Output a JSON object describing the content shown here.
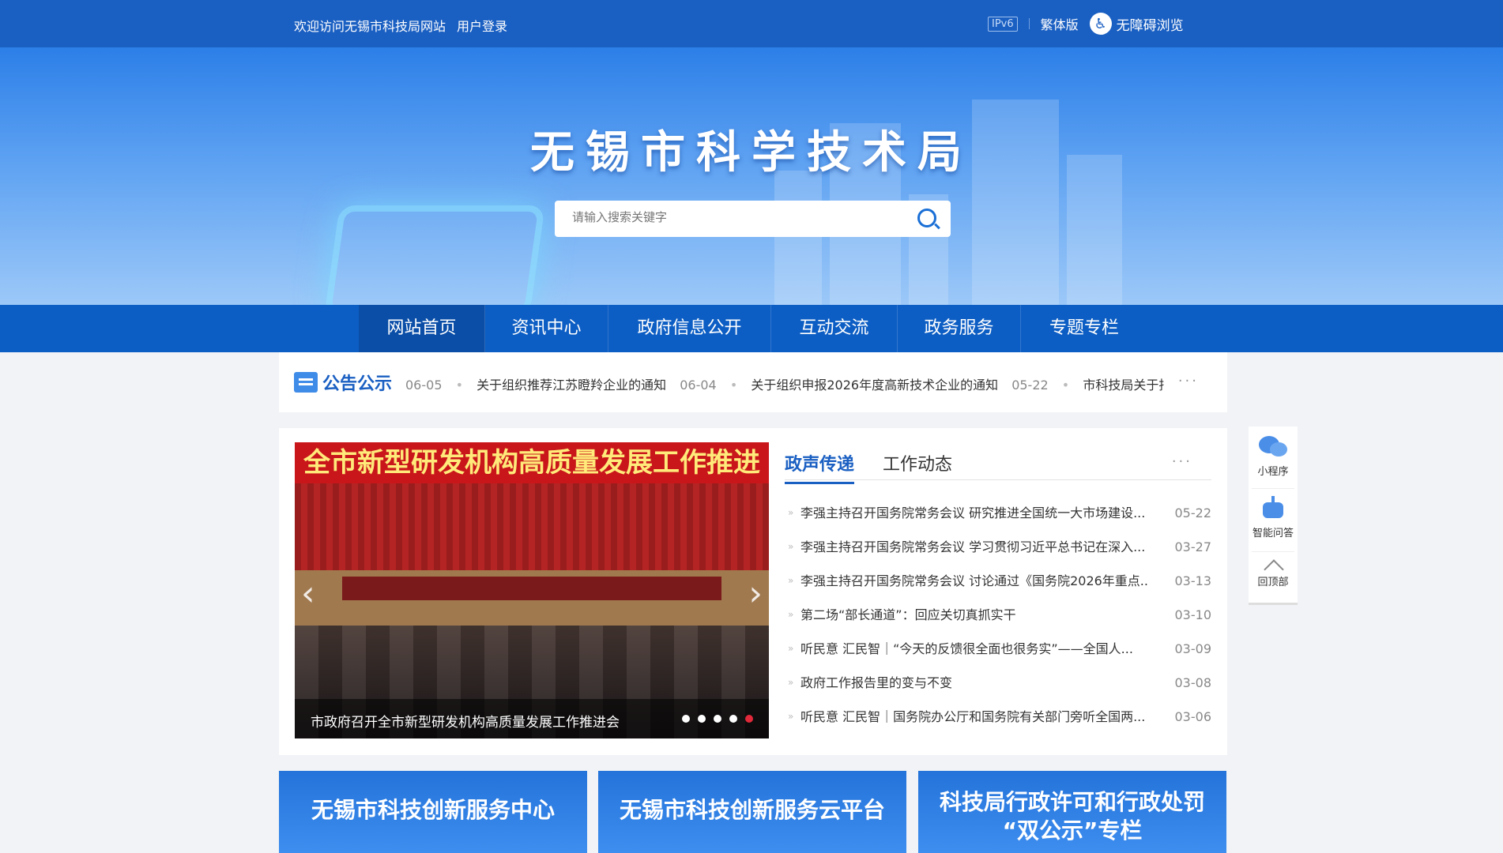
{
  "topbar": {
    "welcome": "欢迎访问无锡市科技局网站",
    "login": "用户登录",
    "ipv6": "IPv6",
    "traditional": "繁体版",
    "accessibility": "无障碍浏览"
  },
  "banner": {
    "title": "无锡市科学技术局",
    "search_placeholder": "请输入搜索关键字"
  },
  "nav": {
    "items": [
      {
        "label": "网站首页"
      },
      {
        "label": "资讯中心"
      },
      {
        "label": "政府信息公开"
      },
      {
        "label": "互动交流"
      },
      {
        "label": "政务服务"
      },
      {
        "label": "专题专栏"
      }
    ]
  },
  "notice": {
    "label": "公告公示",
    "items": [
      {
        "date": "06-05",
        "title": "关于组织推荐江苏瞪羚企业的通知"
      },
      {
        "date": "06-04",
        "title": "关于组织申报2026年度高新技术企业的通知"
      },
      {
        "date": "05-22",
        "title": "市科技局关于拒"
      }
    ],
    "more": "···"
  },
  "carousel": {
    "photo_banner": "全市新型研发机构高质量发展工作推进会",
    "caption": "市政府召开全市新型研发机构高质量发展工作推进会",
    "slide_count": 5,
    "active_slide": 5
  },
  "news": {
    "tabs": [
      {
        "label": "政声传递"
      },
      {
        "label": "工作动态"
      }
    ],
    "more": "···",
    "items": [
      {
        "title": "李强主持召开国务院常务会议 研究推进全国统一大市场建设...",
        "date": "05-22"
      },
      {
        "title": "李强主持召开国务院常务会议 学习贯彻习近平总书记在深入...",
        "date": "03-27"
      },
      {
        "title": "李强主持召开国务院常务会议 讨论通过《国务院2026年重点...",
        "date": "03-13"
      },
      {
        "title": "第二场“部长通道”：回应关切真抓实干",
        "date": "03-10"
      },
      {
        "title": "听民意 汇民智｜“今天的反馈很全面也很务实”——全国人...",
        "date": "03-09"
      },
      {
        "title": "政府工作报告里的变与不变",
        "date": "03-08"
      },
      {
        "title": "听民意 汇民智｜国务院办公厅和国务院有关部门旁听全国两...",
        "date": "03-06"
      }
    ]
  },
  "tiles": {
    "t1": "无锡市科技创新服务中心",
    "t2": "无锡市科技创新服务云平台",
    "t3_line1": "科技局行政许可和行政处罚",
    "t3_line2": "“双公示”专栏"
  },
  "side": {
    "mini_program": "小程序",
    "ai_qa": "智能问答",
    "back_top": "回顶部"
  },
  "colors": {
    "primary": "#1a5fc2",
    "nav": "#0d5ec4",
    "active_dot": "#e0293a"
  }
}
